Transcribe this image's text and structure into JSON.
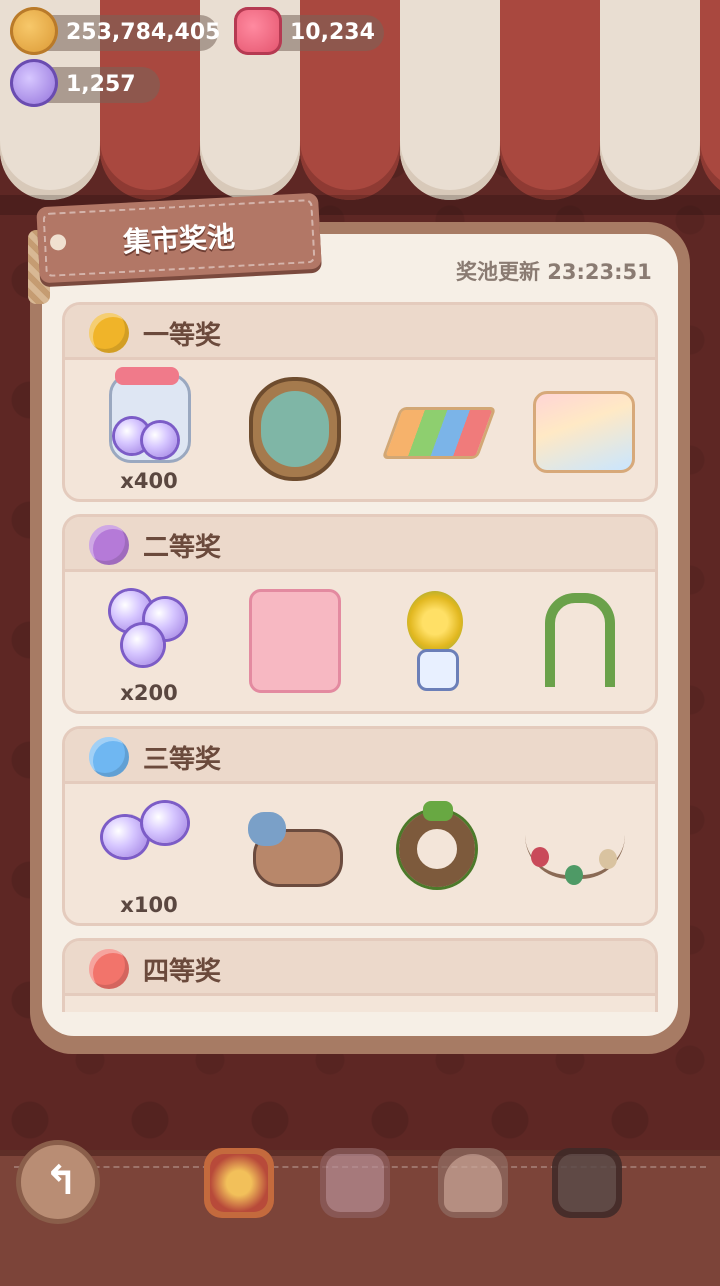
{
  "currencies": {
    "coins": "253,784,405",
    "gems": "10,234",
    "candy": "1,257"
  },
  "panel": {
    "title": "集市奖池",
    "refresh_label": "奖池更新 23:23:51"
  },
  "tiers": [
    {
      "name": "一等奖",
      "orb_color": "#f0b429",
      "items": [
        "candy-jar",
        "fish-tank-clock",
        "hopscotch-mat",
        "playground-slide"
      ],
      "qty": "x400"
    },
    {
      "name": "二等奖",
      "orb_color": "#b57ad8",
      "items": [
        "candy-pile",
        "pink-cabinet",
        "flower-vase",
        "flower-arch"
      ],
      "qty": "x200"
    },
    {
      "name": "三等奖",
      "orb_color": "#6fb7f2",
      "items": [
        "candy-pair",
        "cow-plush",
        "wreath",
        "bead-garland"
      ],
      "qty": "x100"
    },
    {
      "name": "四等奖",
      "orb_color": "#f2746b",
      "items": [],
      "qty": ""
    }
  ],
  "bottom_nav": [
    "back",
    "ferris-wheel-tab",
    "plush-tab",
    "house-tab",
    "dark-tab"
  ]
}
